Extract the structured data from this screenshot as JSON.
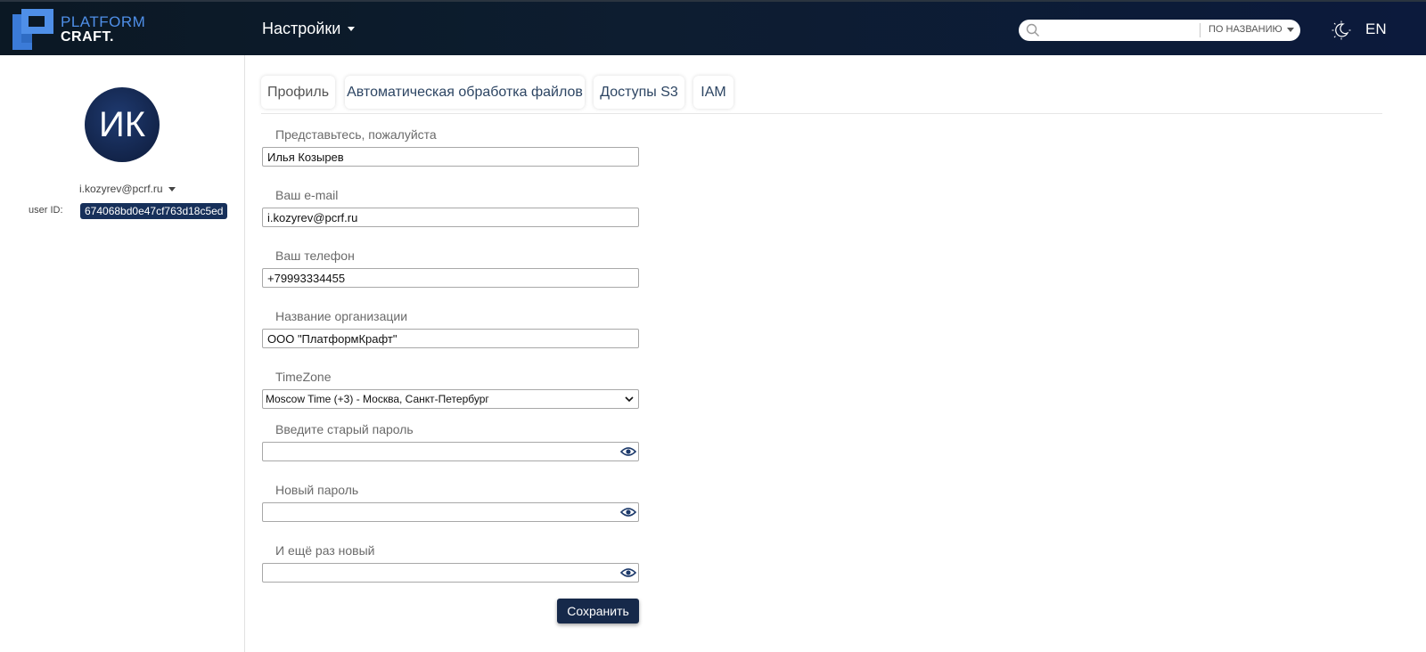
{
  "header": {
    "logo_line1": "PLATFORM",
    "logo_line2": "CRAFT.",
    "settings_label": "Настройки",
    "search": {
      "placeholder": "",
      "mode_label": "ПО НАЗВАНИЮ"
    },
    "language": "EN",
    "icons": {
      "search": "search-icon",
      "theme": "theme-toggle-icon"
    }
  },
  "user": {
    "initials": "ИК",
    "email": "i.kozyrev@pcrf.ru",
    "id_label": "user ID:",
    "id_value": "674068bd0e47cf763d18c5ed"
  },
  "tabs": [
    {
      "label": "Профиль",
      "active": true
    },
    {
      "label": "Автоматическая обработка файлов",
      "active": false
    },
    {
      "label": "Доступы S3",
      "active": false
    },
    {
      "label": "IAM",
      "active": false
    }
  ],
  "form": {
    "name": {
      "label": "Представьтесь, пожалуйста",
      "value": "Илья Козырев"
    },
    "email": {
      "label": "Ваш e-mail",
      "value": "i.kozyrev@pcrf.ru"
    },
    "phone": {
      "label": "Ваш телефон",
      "value": "+79993334455"
    },
    "org": {
      "label": "Название организации",
      "value": "ООО \"ПлатформКрафт\""
    },
    "timezone": {
      "label": "TimeZone",
      "value": "Moscow Time (+3) - Москва, Санкт-Петербург"
    },
    "old_password": {
      "label": "Введите старый пароль",
      "value": ""
    },
    "new_password": {
      "label": "Новый пароль",
      "value": ""
    },
    "repeat_password": {
      "label": "И ещё раз новый",
      "value": ""
    },
    "save_label": "Сохранить"
  },
  "colors": {
    "header_bg": "#0d1d30",
    "accent": "#16294a",
    "logo_blue": "#4f8fe8"
  }
}
